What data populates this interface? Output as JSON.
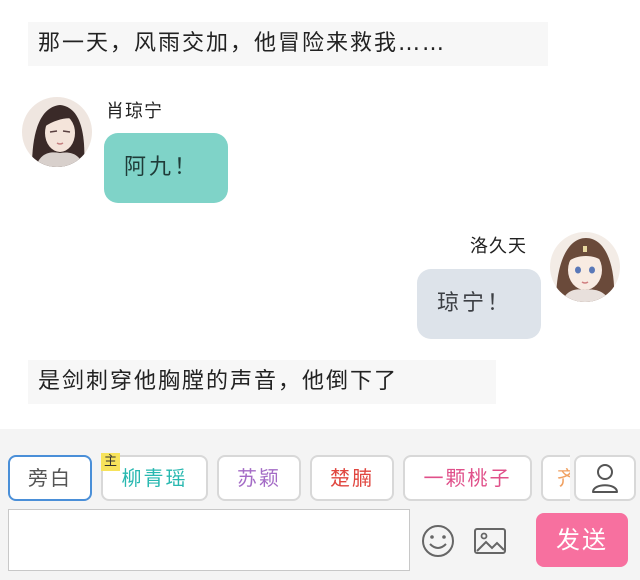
{
  "story": {
    "narration_1": "那一天，风雨交加，他冒险来救我……",
    "narration_2": "是剑刺穿他胸膛的声音，他倒下了"
  },
  "messages": [
    {
      "speaker": "肖琼宁",
      "text": "阿九！",
      "side": "left",
      "bubble_color": "#7fd3c8"
    },
    {
      "speaker": "洛久天",
      "text": "琼宁！",
      "side": "right",
      "bubble_color": "#dde3ea"
    }
  ],
  "input_bar": {
    "characters": [
      {
        "label": "旁白",
        "color": "#555555",
        "selected": true
      },
      {
        "label": "柳青瑶",
        "color": "#28b8b0",
        "badge": "主"
      },
      {
        "label": "苏颖",
        "color": "#a46cc6"
      },
      {
        "label": "楚腩",
        "color": "#e0463f"
      },
      {
        "label": "一颗桃子",
        "color": "#e0508a"
      },
      {
        "label": "齐",
        "color": "#f0a060"
      }
    ],
    "message_value": "",
    "send_label": "发送",
    "send_color": "#f7709f"
  },
  "icons": {
    "role": "person-icon",
    "emoji": "smiley-icon",
    "image": "image-icon"
  }
}
